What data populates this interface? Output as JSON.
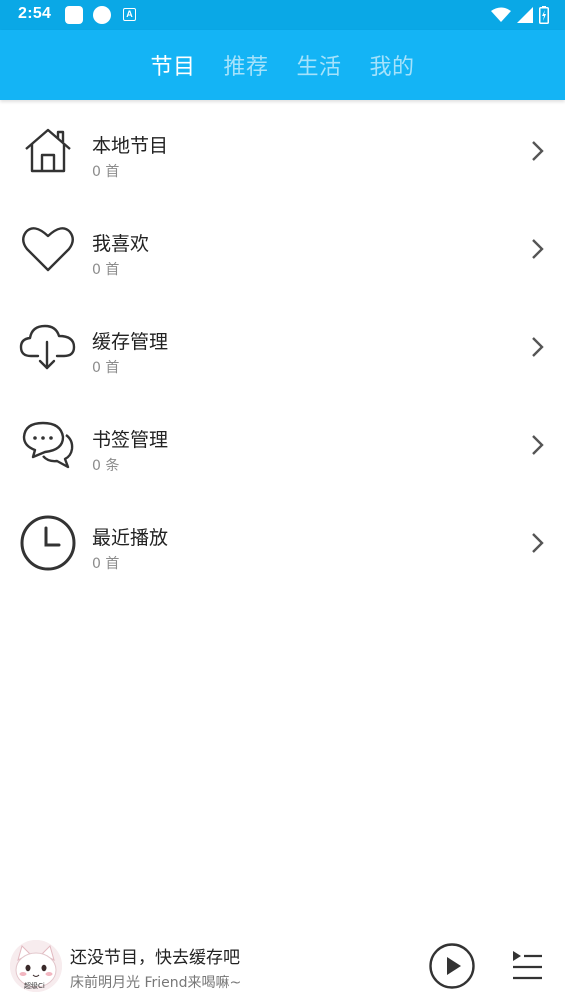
{
  "status": {
    "time": "2:54",
    "notif_icons": [
      "square-app-icon",
      "circle-app-icon",
      "a-box-icon"
    ],
    "right_icons": [
      "wifi-icon",
      "signal-icon",
      "battery-icon"
    ]
  },
  "tabs": [
    {
      "label": "节目",
      "active": true
    },
    {
      "label": "推荐",
      "active": false
    },
    {
      "label": "生活",
      "active": false
    },
    {
      "label": "我的",
      "active": false
    }
  ],
  "menu": [
    {
      "title": "本地节目",
      "count": "0 首",
      "icon": "home-icon"
    },
    {
      "title": "我喜欢",
      "count": "0 首",
      "icon": "heart-icon"
    },
    {
      "title": "缓存管理",
      "count": "0 首",
      "icon": "cloud-download-icon"
    },
    {
      "title": "书签管理",
      "count": "0 条",
      "icon": "chat-bubbles-icon"
    },
    {
      "title": "最近播放",
      "count": "0 首",
      "icon": "clock-icon"
    }
  ],
  "player": {
    "title": "还没节目，快去缓存吧",
    "subtitle": "床前明月光 Friend来喝嘛~",
    "avatar_caption": "超级Ci"
  },
  "colors": {
    "status_bar": "#0aa8e6",
    "header": "#14b4f5",
    "icon_stroke": "#333333"
  }
}
